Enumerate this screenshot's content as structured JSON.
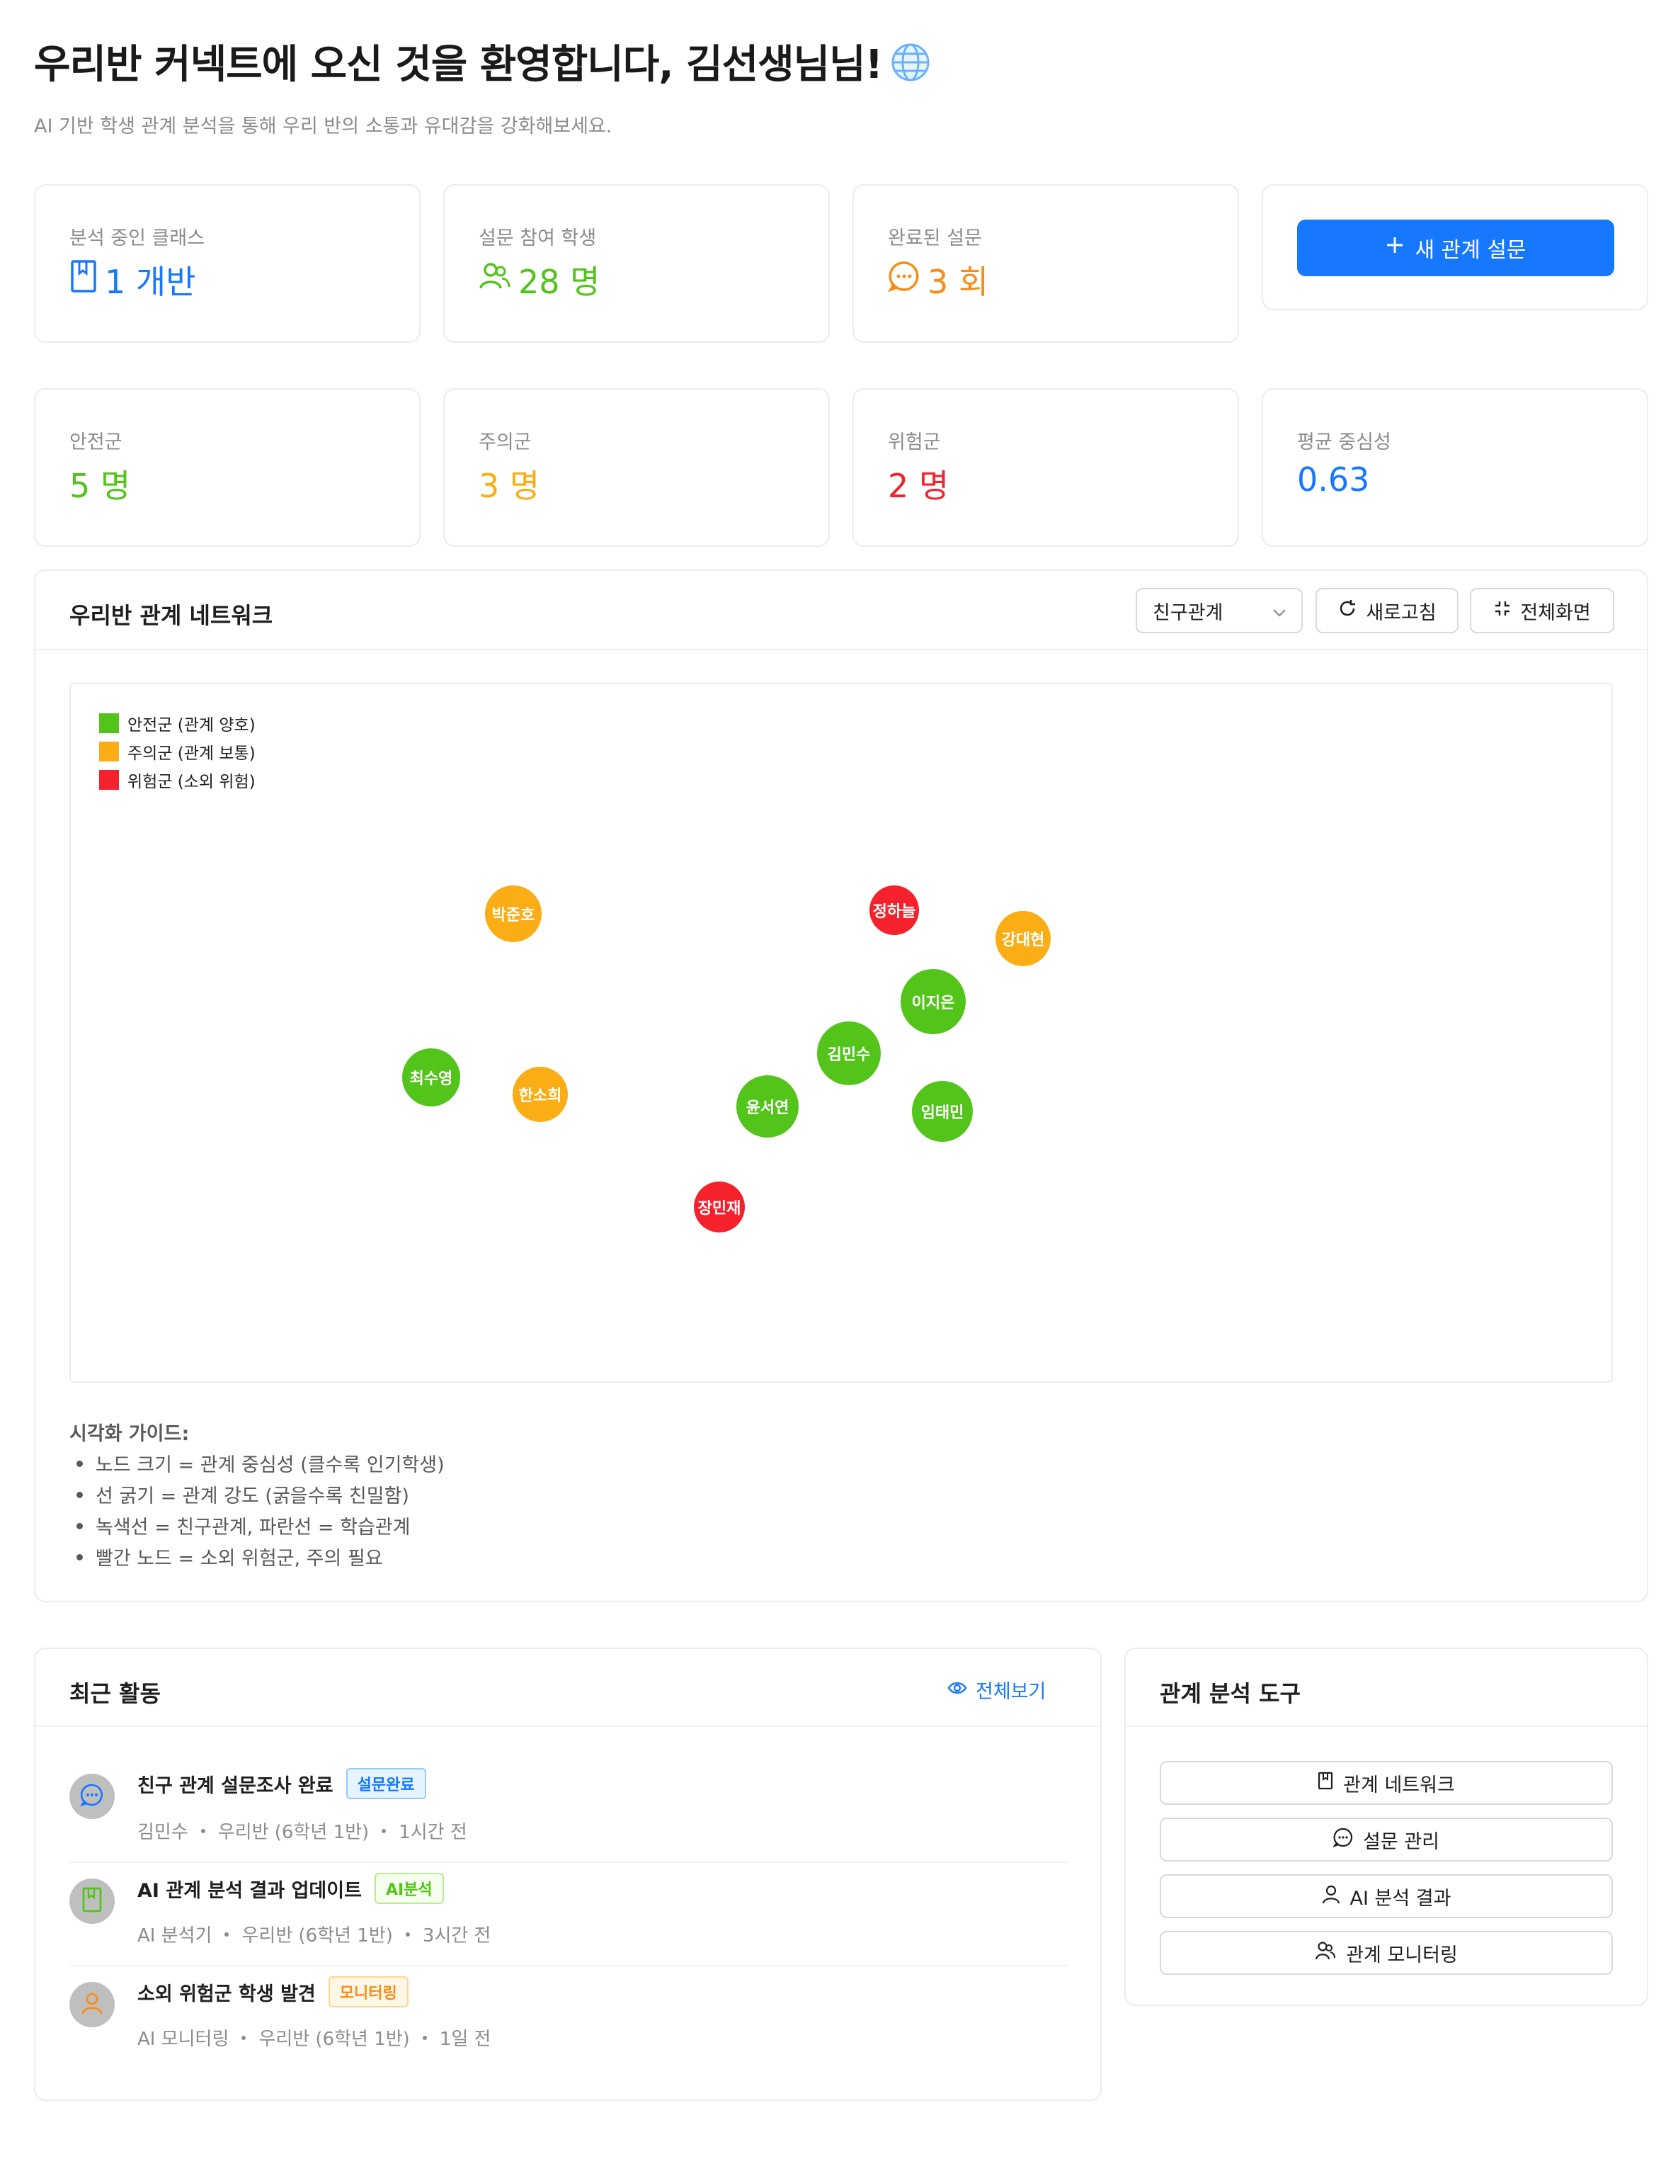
{
  "header": {
    "title": "우리반 커넥트에 오신 것을 환영합니다, 김선생님님!",
    "subtitle": "AI 기반 학생 관계 분석을 통해 우리 반의 소통과 유대감을 강화해보세요."
  },
  "stats_top": [
    {
      "label": "분석 중인 클래스",
      "value": "1 개반",
      "icon": "book-icon",
      "color": "#1677ff"
    },
    {
      "label": "설문 참여 학생",
      "value": "28 명",
      "icon": "team-icon",
      "color": "#52c41a"
    },
    {
      "label": "완료된 설문",
      "value": "3 회",
      "icon": "message-icon",
      "color": "#fa8c16"
    }
  ],
  "new_survey_button": {
    "label": "새 관계 설문",
    "icon": "plus-icon"
  },
  "stats_bottom": [
    {
      "label": "안전군",
      "value": "5 명",
      "color": "#52c41a"
    },
    {
      "label": "주의군",
      "value": "3 명",
      "color": "#faad14"
    },
    {
      "label": "위험군",
      "value": "2 명",
      "color": "#f5222d"
    },
    {
      "label": "평균 중심성",
      "value": "0.63",
      "color": "#1677ff"
    }
  ],
  "network": {
    "title": "우리반 관계 네트워크",
    "select_value": "친구관계",
    "refresh_label": "새로고침",
    "fullscreen_label": "전체화면",
    "legend": [
      {
        "label": "안전군 (관계 양호)",
        "color": "#52c41a"
      },
      {
        "label": "주의군 (관계 보통)",
        "color": "#faad14"
      },
      {
        "label": "위험군 (소외 위험)",
        "color": "#f5222d"
      }
    ],
    "nodes": [
      {
        "name": "박준호",
        "group": "주의군"
      },
      {
        "name": "정하늘",
        "group": "위험군"
      },
      {
        "name": "강대현",
        "group": "주의군"
      },
      {
        "name": "이지은",
        "group": "안전군"
      },
      {
        "name": "김민수",
        "group": "안전군"
      },
      {
        "name": "최수영",
        "group": "안전군"
      },
      {
        "name": "한소희",
        "group": "주의군"
      },
      {
        "name": "윤서연",
        "group": "안전군"
      },
      {
        "name": "임태민",
        "group": "안전군"
      },
      {
        "name": "장민재",
        "group": "위험군"
      }
    ],
    "guide_title": "시각화 가이드:",
    "guide_items": [
      "노드 크기 = 관계 중심성 (클수록 인기학생)",
      "선 굵기 = 관계 강도 (굵을수록 친밀함)",
      "녹색선 = 친구관계, 파란선 = 학습관계",
      "빨간 노드 = 소외 위험군, 주의 필요"
    ]
  },
  "activity": {
    "title": "최근 활동",
    "view_all": "전체보기",
    "items": [
      {
        "title": "친구 관계 설문조사 완료",
        "tag": "설문완료",
        "who": "김민수",
        "class": "우리반 (6학년 1반)",
        "time": "1시간 전",
        "icon": "message-icon"
      },
      {
        "title": "AI 관계 분석 결과 업데이트",
        "tag": "AI분석",
        "who": "AI 분석기",
        "class": "우리반 (6학년 1반)",
        "time": "3시간 전",
        "icon": "book-icon"
      },
      {
        "title": "소외 위험군 학생 발견",
        "tag": "모니터링",
        "who": "AI 모니터링",
        "class": "우리반 (6학년 1반)",
        "time": "1일 전",
        "icon": "user-icon"
      }
    ]
  },
  "tools": {
    "title": "관계 분석 도구",
    "buttons": [
      {
        "label": "관계 네트워크",
        "icon": "book-icon"
      },
      {
        "label": "설문 관리",
        "icon": "message-icon"
      },
      {
        "label": "AI 분석 결과",
        "icon": "user-icon"
      },
      {
        "label": "관계 모니터링",
        "icon": "team-icon"
      }
    ]
  }
}
